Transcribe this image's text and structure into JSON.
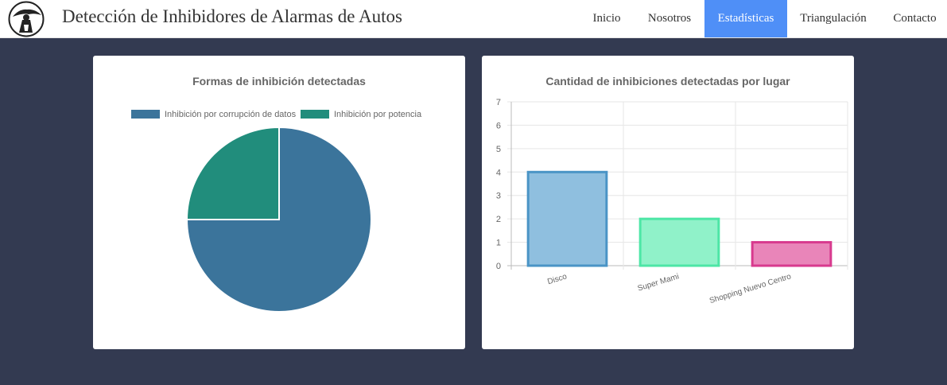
{
  "header": {
    "logo_icon": "hooded-figure-logo-icon",
    "title": "Detección de Inhibidores de Alarmas de Autos",
    "nav": [
      {
        "label": "Inicio",
        "active": false
      },
      {
        "label": "Nosotros",
        "active": false
      },
      {
        "label": "Estadísticas",
        "active": true
      },
      {
        "label": "Triangulación",
        "active": false
      },
      {
        "label": "Contacto",
        "active": false
      }
    ],
    "active_color": "#4f8ff7"
  },
  "page": {
    "background": "#333a51"
  },
  "chart_data": [
    {
      "type": "pie",
      "title": "Formas de inhibición detectadas",
      "labels": [
        "Inhibición por corrupción de datos",
        "Inhibición por potencia"
      ],
      "values": [
        3,
        1
      ],
      "colors": [
        "#3b749b",
        "#218d7c"
      ],
      "legend": "top"
    },
    {
      "type": "bar",
      "title": "Cantidad de inhibiciones detectadas por lugar",
      "categories": [
        "Disco",
        "Super Mami",
        "Shopping Nuevo Centro"
      ],
      "values": [
        4,
        2,
        1
      ],
      "ylim": [
        0,
        7
      ],
      "yticks": [
        0,
        1,
        2,
        3,
        4,
        5,
        6,
        7
      ],
      "fill_colors": [
        "#8fbfdf",
        "#90f2c9",
        "#e985b9"
      ],
      "border_colors": [
        "#4a94c6",
        "#4de6a6",
        "#d83a8e"
      ],
      "grid": true,
      "legend": "none"
    }
  ]
}
